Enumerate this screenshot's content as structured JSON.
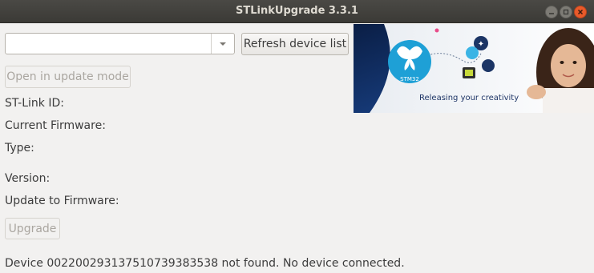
{
  "window": {
    "title": "STLinkUpgrade 3.3.1"
  },
  "device_selector": {
    "selected_value": ""
  },
  "buttons": {
    "refresh": "Refresh device list",
    "open_update": "Open in update mode",
    "upgrade": "Upgrade"
  },
  "labels": {
    "stlink_id": "ST-Link ID:",
    "current_firmware": "Current Firmware:",
    "type": "Type:",
    "version": "Version:",
    "update_to_firmware": "Update to Firmware:"
  },
  "banner": {
    "logo_text": "STM32",
    "tagline": "Releasing your creativity"
  },
  "status": {
    "message": "Device 002200293137510739383538 not found. No device connected."
  },
  "colors": {
    "titlebar": "#3d3c38",
    "close_button": "#e95a2a",
    "banner_bg": "#0d2550",
    "logo_circle": "#1ea0d6"
  },
  "icons": {
    "minimize": "minimize-icon",
    "maximize": "maximize-icon",
    "close": "close-icon",
    "dropdown": "chevron-down-icon"
  }
}
